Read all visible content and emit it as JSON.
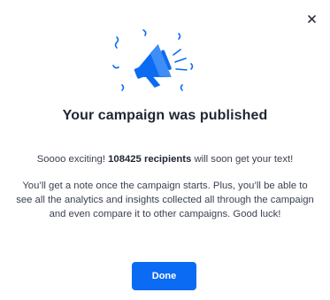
{
  "dialog": {
    "title": "Your campaign was published",
    "intro_prefix": "Soooo exciting! ",
    "intro_bold": "108425 recipients",
    "intro_suffix": " will soon get your text!",
    "body": "You’ll get a note once the campaign starts. Plus, you’ll be able to see all the analytics and insights collected all through the campaign and even compare it to other campaigns. Good luck!",
    "done_label": "Done",
    "close_icon": "close-icon",
    "illustration_icon": "megaphone-icon"
  },
  "colors": {
    "accent": "#0b6bf2",
    "title": "#1f2633",
    "text": "#3a4150"
  }
}
